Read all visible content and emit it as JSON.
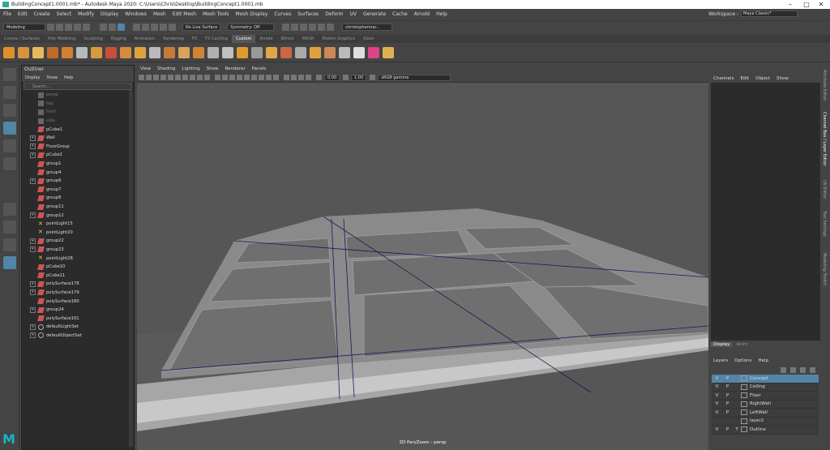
{
  "window": {
    "title": "BuildingConcept1.0001.mb* - Autodesk Maya 2020: C:\\Users\\Chris\\Desktop\\BuildingConcept1.0001.mb"
  },
  "menubar": [
    "File",
    "Edit",
    "Create",
    "Select",
    "Modify",
    "Display",
    "Windows",
    "Mesh",
    "Edit Mesh",
    "Mesh Tools",
    "Mesh Display",
    "Curves",
    "Surfaces",
    "Deform",
    "UV",
    "Generate",
    "Cache",
    "Arnold",
    "Help"
  ],
  "workspace": {
    "label": "Workspace :",
    "value": "Maya Classic*"
  },
  "statusline": {
    "mode": "Modeling",
    "live": "No Live Surface",
    "symmetry": "Symmetry: Off",
    "user": "christophermar..."
  },
  "shelf_tabs": [
    "Curves / Surfaces",
    "Poly Modeling",
    "Sculpting",
    "Rigging",
    "Animation",
    "Rendering",
    "FX",
    "FX Caching",
    "Custom",
    "Arnold",
    "Bifrost",
    "MASH",
    "Motion Graphics",
    "XGen"
  ],
  "shelf_active": "Custom",
  "outliner": {
    "title": "Outliner",
    "menu": [
      "Display",
      "Show",
      "Help"
    ],
    "search_placeholder": "Search...",
    "items": [
      {
        "label": "persp",
        "kind": "cam",
        "expand": false,
        "dim": true
      },
      {
        "label": "top",
        "kind": "cam",
        "expand": false,
        "dim": true
      },
      {
        "label": "front",
        "kind": "cam",
        "expand": false,
        "dim": true
      },
      {
        "label": "side",
        "kind": "cam",
        "expand": false,
        "dim": true
      },
      {
        "label": "pCube1",
        "kind": "mesh",
        "expand": false,
        "dim": false
      },
      {
        "label": "Wall",
        "kind": "mesh",
        "expand": true,
        "dim": false
      },
      {
        "label": "FloorGroup",
        "kind": "mesh",
        "expand": true,
        "dim": false
      },
      {
        "label": "pCube2",
        "kind": "mesh",
        "expand": true,
        "dim": false
      },
      {
        "label": "group1",
        "kind": "mesh",
        "expand": false,
        "dim": false
      },
      {
        "label": "group4",
        "kind": "mesh",
        "expand": false,
        "dim": false
      },
      {
        "label": "group6",
        "kind": "mesh",
        "expand": true,
        "dim": false
      },
      {
        "label": "group7",
        "kind": "mesh",
        "expand": false,
        "dim": false
      },
      {
        "label": "group8",
        "kind": "mesh",
        "expand": false,
        "dim": false
      },
      {
        "label": "group11",
        "kind": "mesh",
        "expand": false,
        "dim": false
      },
      {
        "label": "group12",
        "kind": "mesh",
        "expand": true,
        "dim": false
      },
      {
        "label": "pointLight15",
        "kind": "light",
        "expand": false,
        "dim": false
      },
      {
        "label": "pointLight20",
        "kind": "light",
        "expand": false,
        "dim": false
      },
      {
        "label": "group22",
        "kind": "mesh",
        "expand": true,
        "dim": false
      },
      {
        "label": "group23",
        "kind": "mesh",
        "expand": true,
        "dim": false
      },
      {
        "label": "pointLight28",
        "kind": "light",
        "expand": false,
        "dim": false
      },
      {
        "label": "pCube10",
        "kind": "mesh",
        "expand": false,
        "dim": false
      },
      {
        "label": "pCube11",
        "kind": "mesh",
        "expand": false,
        "dim": false
      },
      {
        "label": "polySurface178",
        "kind": "mesh",
        "expand": true,
        "dim": false
      },
      {
        "label": "polySurface179",
        "kind": "mesh",
        "expand": true,
        "dim": false
      },
      {
        "label": "polySurface180",
        "kind": "mesh",
        "expand": false,
        "dim": false
      },
      {
        "label": "group24",
        "kind": "mesh",
        "expand": true,
        "dim": false
      },
      {
        "label": "polySurface191",
        "kind": "mesh",
        "expand": false,
        "dim": false
      },
      {
        "label": "defaultLightSet",
        "kind": "set",
        "expand": true,
        "dim": false
      },
      {
        "label": "defaultObjectSet",
        "kind": "set",
        "expand": true,
        "dim": false
      }
    ]
  },
  "viewport": {
    "menu": [
      "View",
      "Shading",
      "Lighting",
      "Show",
      "Renderer",
      "Panels"
    ],
    "exposure": "0.00",
    "gamma": "1.00",
    "colorspace": "sRGB gamma",
    "camera_label": "2D Pan/Zoom : persp"
  },
  "channelbox": {
    "menu": [
      "Channels",
      "Edit",
      "Object",
      "Show"
    ]
  },
  "layers": {
    "tabs": [
      "Display",
      "Anim"
    ],
    "menu": [
      "Layers",
      "Options",
      "Help"
    ],
    "rows": [
      {
        "v": "V",
        "p": "P",
        "t": "",
        "name": "Concept",
        "selected": true
      },
      {
        "v": "V",
        "p": "P",
        "t": "",
        "name": "Ceiling",
        "selected": false
      },
      {
        "v": "V",
        "p": "P",
        "t": "",
        "name": "Floor",
        "selected": false
      },
      {
        "v": "V",
        "p": "P",
        "t": "",
        "name": "RightWall",
        "selected": false
      },
      {
        "v": "V",
        "p": "P",
        "t": "",
        "name": "LeftWall",
        "selected": false
      },
      {
        "v": "",
        "p": "",
        "t": "",
        "name": "layer2",
        "selected": false
      },
      {
        "v": "V",
        "p": "P",
        "t": "T",
        "name": "Outline",
        "selected": false
      }
    ]
  },
  "side_tabs": [
    "Attribute Editor",
    "Channel Box / Layer Editor",
    "UV Editor",
    "Tool Settings",
    "Modeling Toolkit"
  ],
  "colors": {
    "accent": "#5285a6",
    "panel": "#444444",
    "dark": "#2b2b2b",
    "viewport": "#565656",
    "maya_logo": "#18b4c8"
  }
}
